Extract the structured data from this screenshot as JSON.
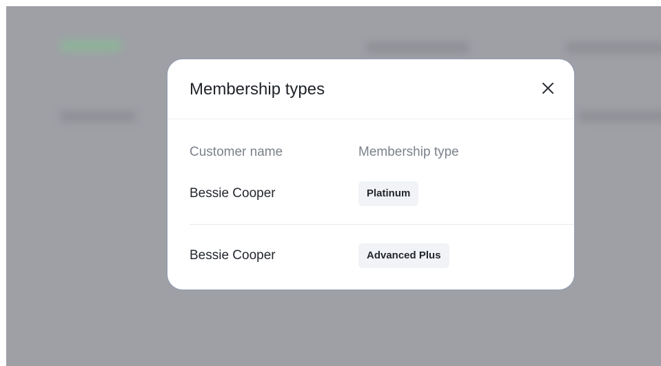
{
  "modal": {
    "title": "Membership types",
    "close_icon": "close-icon",
    "columns": {
      "name": "Customer name",
      "type": "Membership type"
    },
    "rows": [
      {
        "name": "Bessie Cooper",
        "type": "Platinum"
      },
      {
        "name": "Bessie Cooper",
        "type": "Advanced Plus"
      }
    ]
  },
  "colors": {
    "overlay": "#9fa0a6",
    "title": "#1f2328",
    "muted": "#7b808a",
    "badge_bg": "#f1f3f6"
  }
}
